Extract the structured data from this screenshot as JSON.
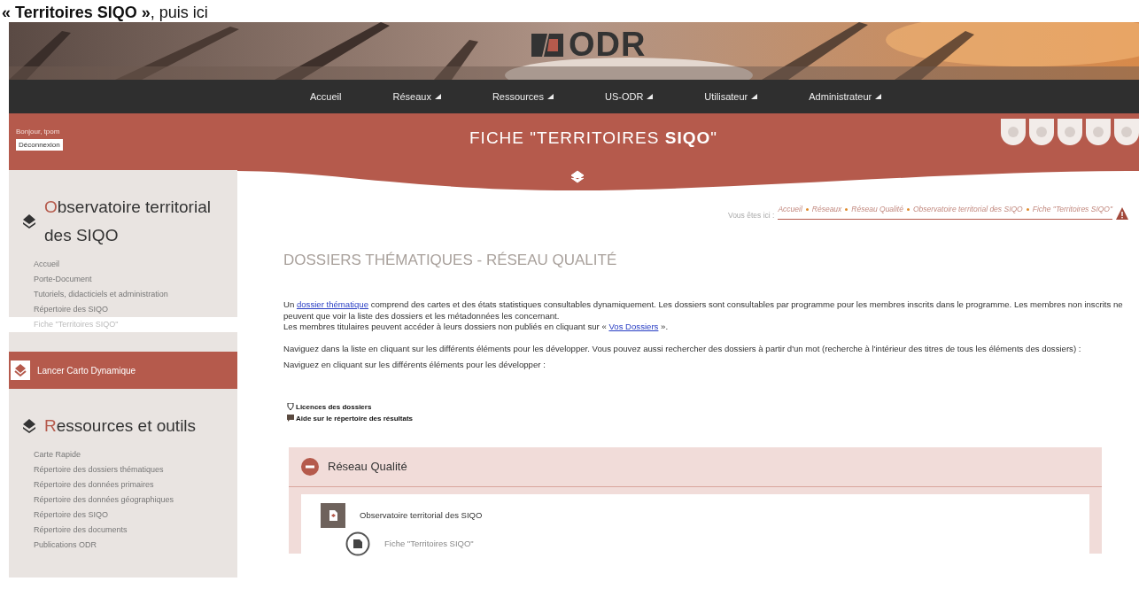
{
  "caption": "**« Territoires SIQO »**, puis ici",
  "logo": {
    "text": "ODR"
  },
  "nav": [
    {
      "label": "Accueil",
      "dropdown": false
    },
    {
      "label": "Réseaux",
      "dropdown": true
    },
    {
      "label": "Ressources",
      "dropdown": true
    },
    {
      "label": "US-ODR",
      "dropdown": true
    },
    {
      "label": "Utilisateur",
      "dropdown": true
    },
    {
      "label": "Administrateur",
      "dropdown": true
    }
  ],
  "user": {
    "greeting": "Bonjour, tpom",
    "logout": "Déconnexion"
  },
  "page_title": "FICHE \"TERRITOIRES **SIQO**\"",
  "sidebar": {
    "sections": [
      {
        "title": "Observatoire territorial des SIQO",
        "items": [
          {
            "label": "Accueil",
            "selected": false
          },
          {
            "label": "Porte-Document",
            "selected": false
          },
          {
            "label": "Tutoriels, didacticiels et administration",
            "selected": false
          },
          {
            "label": "Répertoire des SIQO",
            "selected": false
          },
          {
            "label": "Fiche \"Territoires SIQO\"",
            "selected": true
          }
        ]
      },
      {
        "title": "Ressources et outils",
        "items": [
          {
            "label": "Carte Rapide",
            "selected": false
          },
          {
            "label": "Répertoire des dossiers thématiques",
            "selected": false
          },
          {
            "label": "Répertoire des données primaires",
            "selected": false
          },
          {
            "label": "Répertoire des données géographiques",
            "selected": false
          },
          {
            "label": "Répertoire des SIQO",
            "selected": false
          },
          {
            "label": "Répertoire des documents",
            "selected": false
          },
          {
            "label": "Publications ODR",
            "selected": false
          }
        ]
      }
    ],
    "action_button": "Lancer Carto Dynamique"
  },
  "breadcrumb": {
    "prefix": "Vous êtes ici :",
    "items": [
      "Accueil",
      "Réseaux",
      "Réseau Qualité",
      "Observatoire territorial des SIQO",
      "Fiche \"Territoires SIQO\""
    ]
  },
  "heading": "DOSSIERS THÉMATIQUES - RÉSEAU QUALITÉ",
  "paragraphs": [
    [
      {
        "kind": "text",
        "text": "Un "
      },
      {
        "kind": "link",
        "text": "dossier thématique"
      },
      {
        "kind": "text",
        "text": " comprend des cartes et des états statistiques consultables dynamiquement. Les dossiers sont consultables par programme pour les membres inscrits dans le programme. Les membres non inscrits ne peuvent que voir la liste des dossiers et les métadonnées les concernant."
      }
    ],
    [
      {
        "kind": "text",
        "text": "Les membres titulaires peuvent accéder à leurs dossiers non publiés en cliquant sur « "
      },
      {
        "kind": "link",
        "text": "Vos Dossiers"
      },
      {
        "kind": "text",
        "text": " »."
      }
    ],
    [
      {
        "kind": "text",
        "text": "Naviguez dans la liste en cliquant sur les différents éléments pour les développer. Vous pouvez aussi rechercher des dossiers à partir d'un mot (recherche à l'intérieur des titres de tous les éléments des dossiers) :"
      }
    ],
    [
      {
        "kind": "text",
        "text": "Naviguez en cliquant sur les différents éléments pour les développer :"
      }
    ]
  ],
  "help_links": [
    {
      "kind": "shield",
      "label": "Licences des dossiers"
    },
    {
      "kind": "comment",
      "label": "Aide sur le répertoire des résultats"
    }
  ],
  "tree": [
    {
      "label": "Réseau Qualité",
      "expanded": true,
      "children": [
        {
          "label": "Observatoire territorial des SIQO",
          "expanded": true,
          "children": [
            {
              "label": "Fiche \"Territoires SIQO\""
            }
          ]
        }
      ]
    }
  ]
}
